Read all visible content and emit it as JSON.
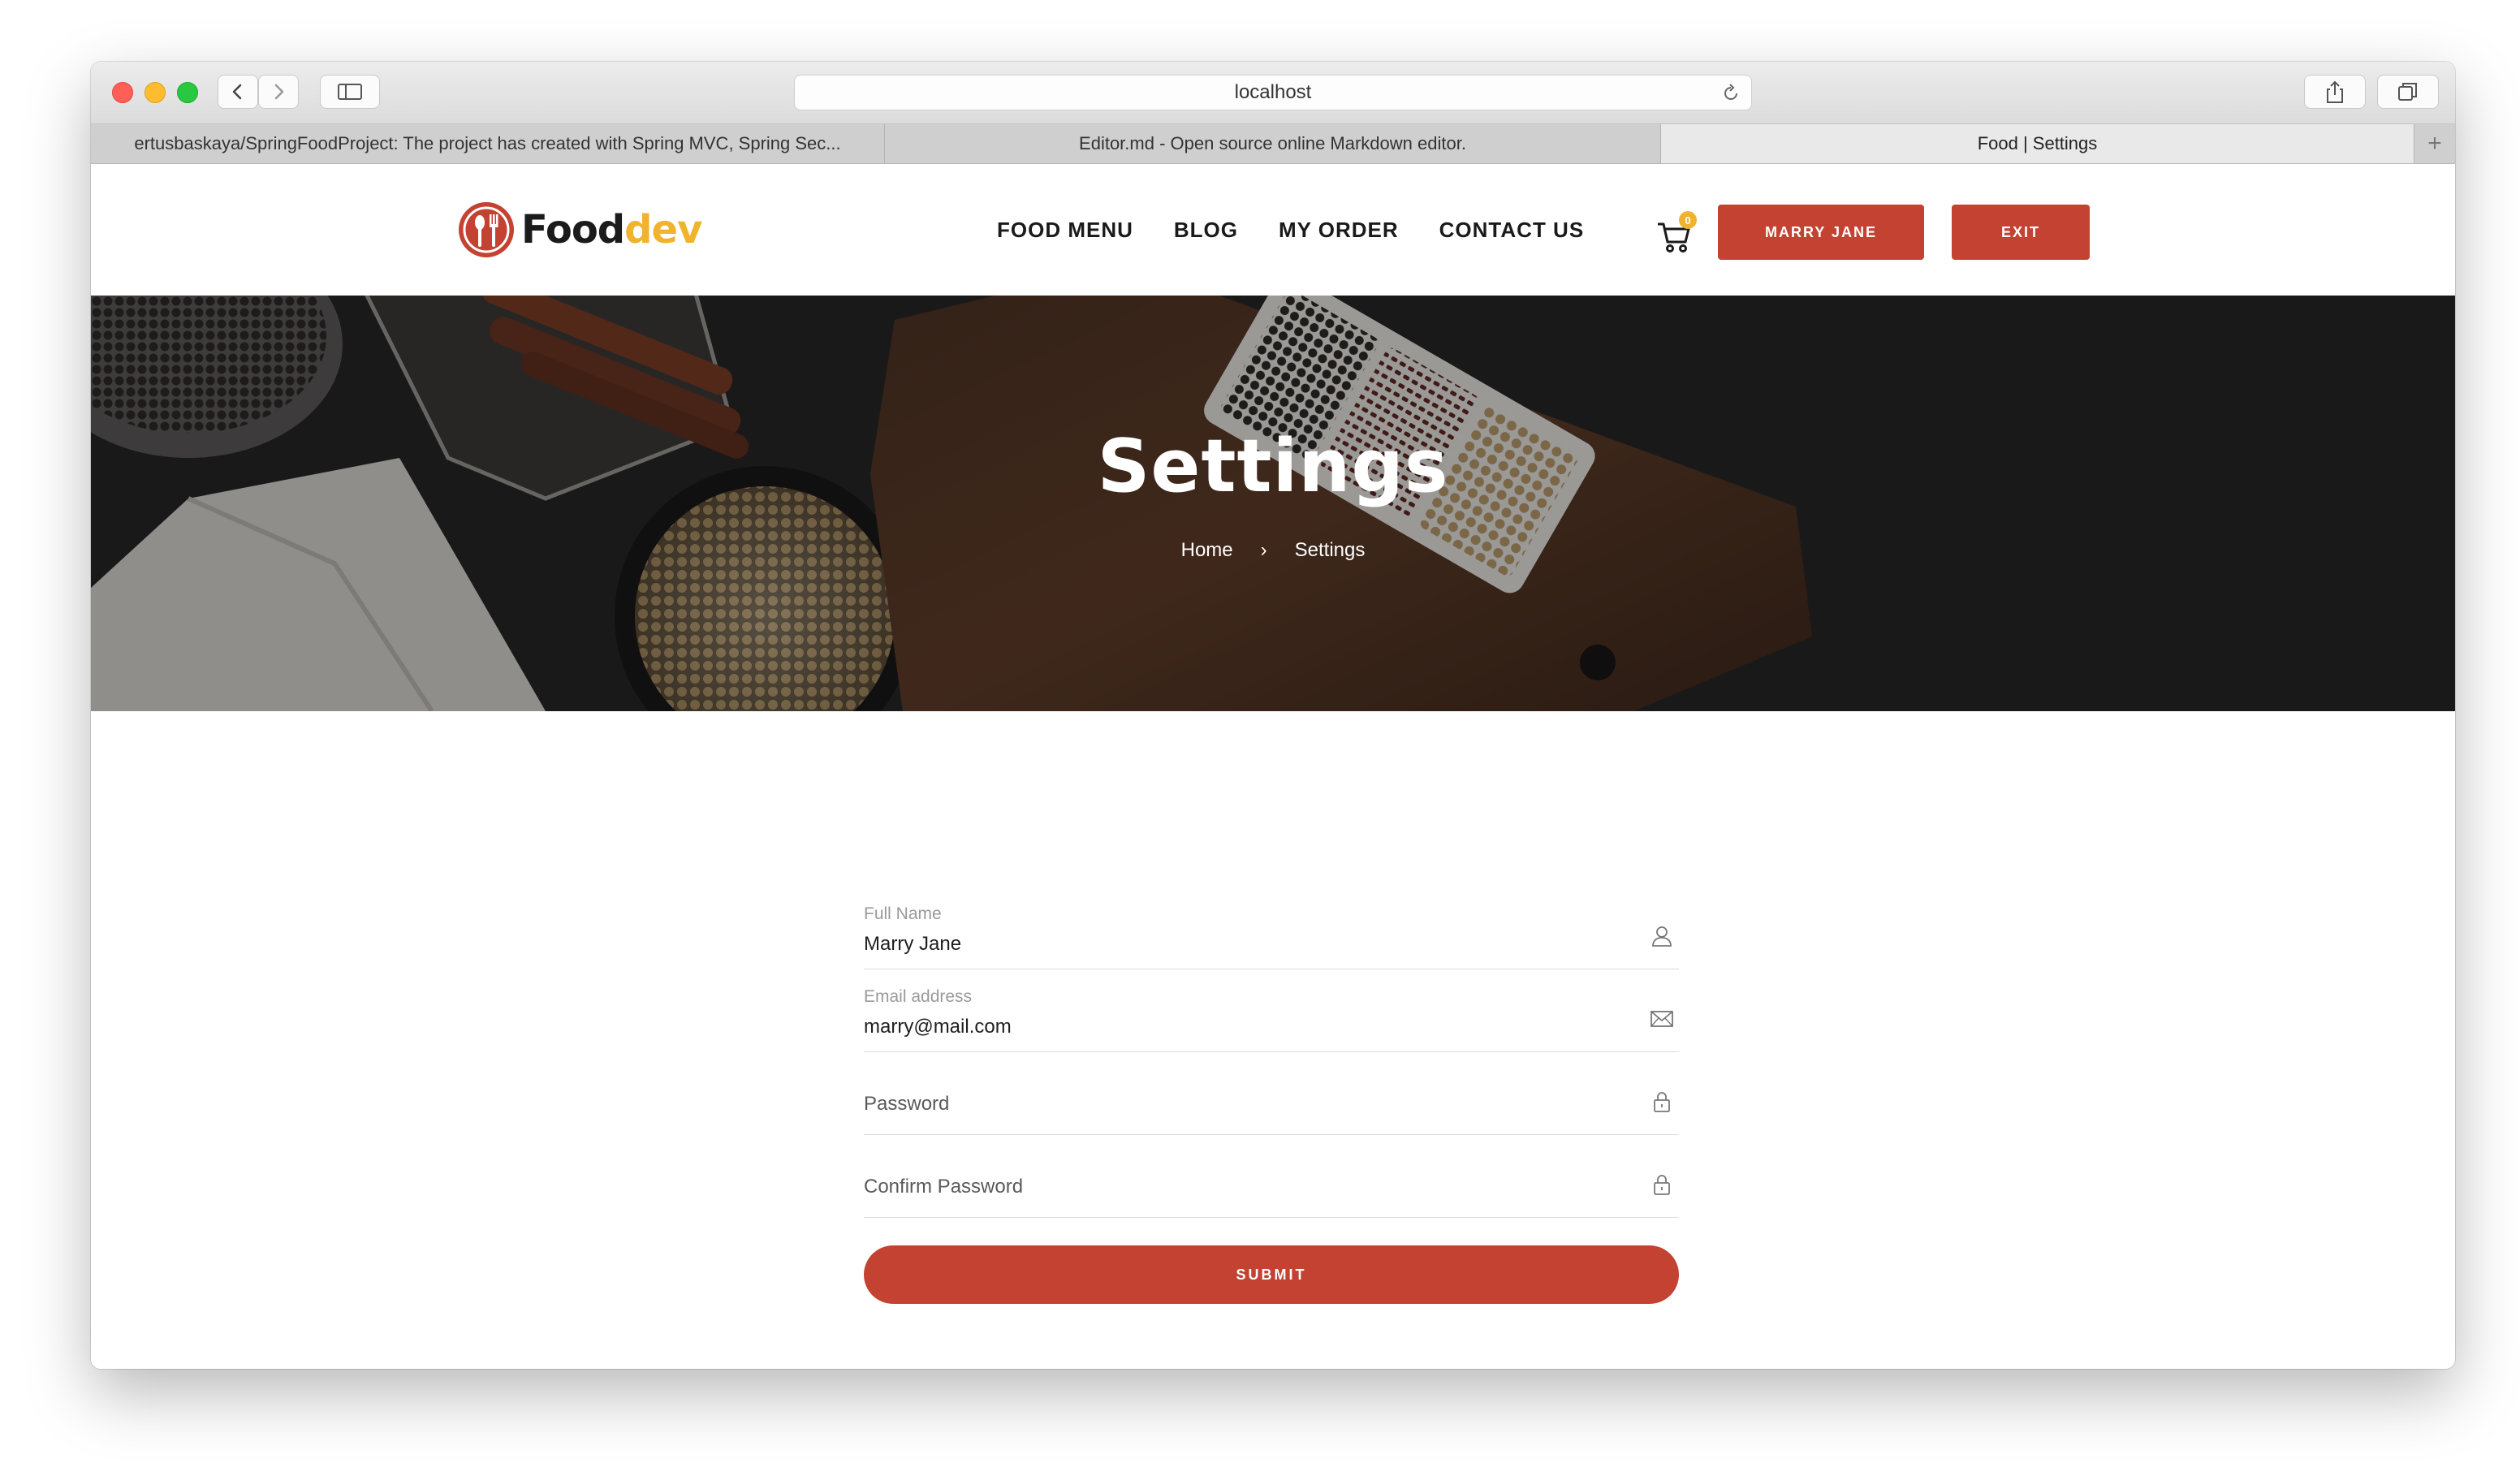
{
  "browser": {
    "url": "localhost",
    "tabs": [
      {
        "title": "ertusbaskaya/SpringFoodProject: The project has created with Spring MVC, Spring Sec...",
        "active": false
      },
      {
        "title": "Editor.md - Open source online Markdown editor.",
        "active": false
      },
      {
        "title": "Food | Settings",
        "active": true
      }
    ],
    "new_tab_label": "+"
  },
  "site": {
    "logo": {
      "word_1": "Food",
      "word_2": "dev"
    },
    "nav": [
      "FOOD MENU",
      "BLOG",
      "MY ORDER",
      "CONTACT US"
    ],
    "cart_count": "0",
    "user_button": "MARRY JANE",
    "exit_button": "EXIT"
  },
  "hero": {
    "title": "Settings",
    "breadcrumb": {
      "home": "Home",
      "separator": "›",
      "current": "Settings"
    }
  },
  "form": {
    "full_name": {
      "label": "Full Name",
      "value": "Marry Jane"
    },
    "email": {
      "label": "Email address",
      "value": "marry@mail.com"
    },
    "password": {
      "placeholder": "Password",
      "value": ""
    },
    "confirm_password": {
      "placeholder": "Confirm Password",
      "value": ""
    },
    "submit_label": "SUBMIT"
  },
  "colors": {
    "accent": "#c44232",
    "logo_yellow": "#f0b32f",
    "nav_text": "#1a1a1a"
  }
}
